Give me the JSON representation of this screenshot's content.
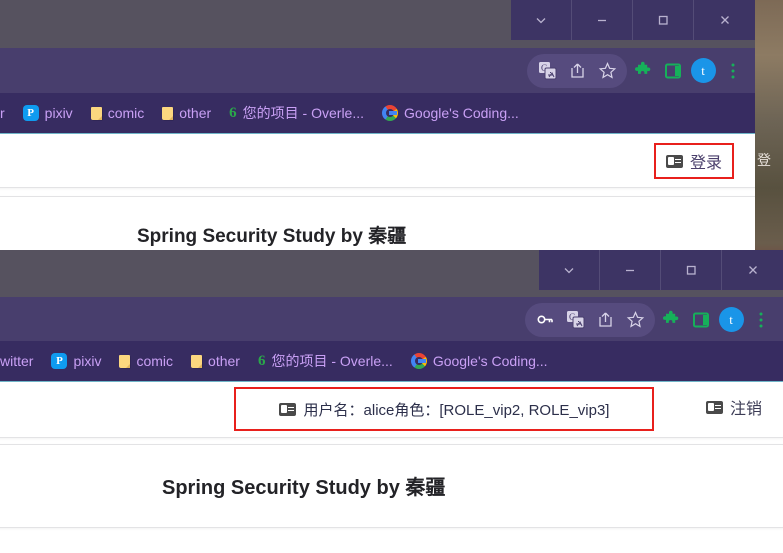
{
  "desktop": {
    "wallpaper_glyph": "登"
  },
  "window_top": {
    "window_controls": [
      {
        "name": "chevron-down",
        "glyph": "v"
      },
      {
        "name": "minimize",
        "glyph": "—"
      },
      {
        "name": "maximize",
        "glyph": "□"
      },
      {
        "name": "close",
        "glyph": "✕"
      }
    ],
    "toolbar": {
      "icons": [
        {
          "name": "translate-icon",
          "label": "译"
        },
        {
          "name": "share-icon",
          "label": "share"
        },
        {
          "name": "bookmark-star-icon",
          "label": "★"
        },
        {
          "name": "extensions-puzzle-icon",
          "label": "puzzle"
        },
        {
          "name": "side-panel-icon",
          "label": "panel"
        }
      ],
      "avatar_letter": "t",
      "menu_label": "⋮"
    },
    "bookmarks": [
      {
        "label": "r",
        "icon": "truncated-bookmark",
        "truncated": true
      },
      {
        "label": "pixiv",
        "icon": "pixiv-icon"
      },
      {
        "label": "comic",
        "icon": "folder-icon"
      },
      {
        "label": "other",
        "icon": "folder-icon"
      },
      {
        "label": "您的项目 - Overle...",
        "icon": "overleaf-icon"
      },
      {
        "label": "Google's Coding...",
        "icon": "google-icon"
      }
    ],
    "page": {
      "login_button": "登录",
      "hero_title": "Spring Security Study by 秦疆"
    }
  },
  "window_bottom": {
    "window_controls": [
      {
        "name": "chevron-down",
        "glyph": "v"
      },
      {
        "name": "minimize",
        "glyph": "—"
      },
      {
        "name": "maximize",
        "glyph": "□"
      },
      {
        "name": "close",
        "glyph": "✕"
      }
    ],
    "toolbar": {
      "icons": [
        {
          "name": "password-key-icon",
          "label": "key"
        },
        {
          "name": "translate-icon",
          "label": "译"
        },
        {
          "name": "share-icon",
          "label": "share"
        },
        {
          "name": "bookmark-star-icon",
          "label": "★"
        },
        {
          "name": "extensions-puzzle-icon",
          "label": "puzzle"
        },
        {
          "name": "side-panel-icon",
          "label": "panel"
        }
      ],
      "avatar_letter": "t",
      "menu_label": "⋮"
    },
    "bookmarks": [
      {
        "label": "witter",
        "icon": "truncated-bookmark",
        "truncated": true
      },
      {
        "label": "pixiv",
        "icon": "pixiv-icon"
      },
      {
        "label": "comic",
        "icon": "folder-icon"
      },
      {
        "label": "other",
        "icon": "folder-icon"
      },
      {
        "label": "您的项目 - Overle...",
        "icon": "overleaf-icon"
      },
      {
        "label": "Google's Coding...",
        "icon": "google-icon"
      }
    ],
    "page": {
      "user_info": "用户名：alice角色：[ROLE_vip2, ROLE_vip3]",
      "logout_button": "注销",
      "hero_title": "Spring Security Study by 秦疆"
    }
  },
  "colors": {
    "titlebar": "#56525f",
    "toolbar": "#483e6d",
    "bookmark_bar": "#372c61",
    "bookmark_text": "#c9a0f5",
    "highlight_box": "#e8201c",
    "avatar": "#1a95e8",
    "extension_green": "#16b05a"
  }
}
